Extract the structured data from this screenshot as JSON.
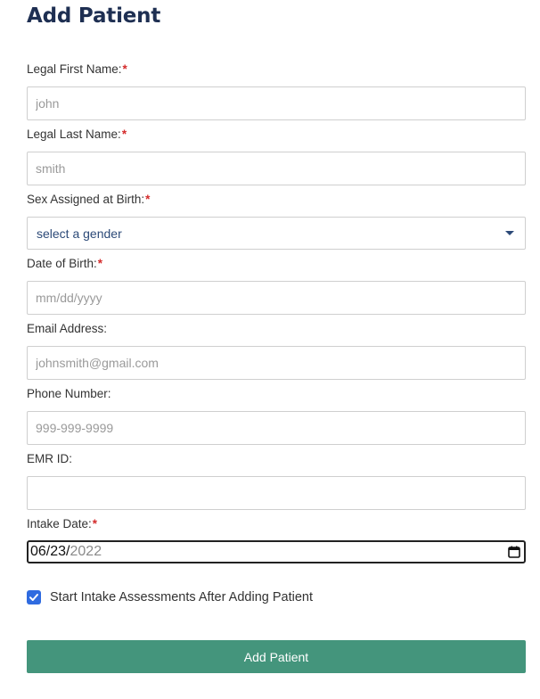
{
  "form": {
    "title": "Add Patient",
    "required_marker": "*",
    "first_name": {
      "label": "Legal First Name:",
      "placeholder": "john",
      "required": true
    },
    "last_name": {
      "label": "Legal Last Name:",
      "placeholder": "smith",
      "required": true
    },
    "sex": {
      "label": "Sex Assigned at Birth:",
      "selected": "select a gender",
      "required": true
    },
    "dob": {
      "label": "Date of Birth:",
      "placeholder": "mm/dd/yyyy",
      "required": true
    },
    "email": {
      "label": "Email Address:",
      "placeholder": "johnsmith@gmail.com",
      "required": false
    },
    "phone": {
      "label": "Phone Number:",
      "placeholder": "999-999-9999",
      "required": false
    },
    "emr": {
      "label": "EMR ID:",
      "placeholder": "",
      "required": false
    },
    "intake": {
      "label": "Intake Date:",
      "required": true,
      "month": "06",
      "day": "23",
      "year": "2022",
      "sep": "/"
    },
    "start_assessments": {
      "label": "Start Intake Assessments After Adding Patient",
      "checked": true
    },
    "submit_label": "Add Patient"
  },
  "colors": {
    "title": "#1e2f52",
    "required": "#d42b2b",
    "button": "#44957c",
    "checkbox": "#2f6be0",
    "select_text": "#2c4a78"
  },
  "icons": {
    "select_caret": "chevron-down-icon",
    "calendar": "calendar-icon",
    "checkbox": "checkmark-icon"
  }
}
